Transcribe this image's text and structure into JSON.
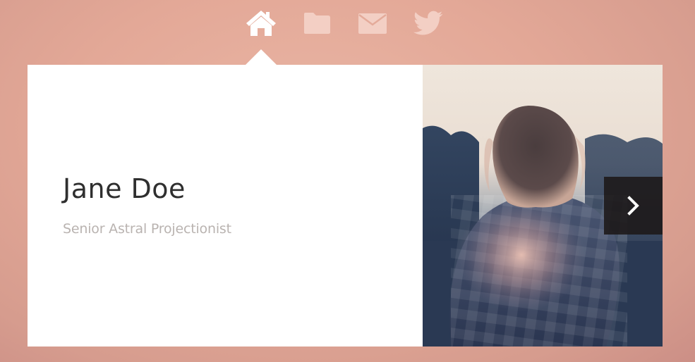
{
  "nav": {
    "items": [
      {
        "icon": "home-icon",
        "active": true
      },
      {
        "icon": "folder-icon",
        "active": false
      },
      {
        "icon": "mail-icon",
        "active": false
      },
      {
        "icon": "twitter-icon",
        "active": false
      }
    ],
    "active_color": "#ffffff",
    "inactive_color": "#f3cfc4"
  },
  "profile": {
    "name": "Jane Doe",
    "title": "Senior Astral Projectionist"
  },
  "photo": {
    "subject": "woman-seen-from-behind-backlit"
  },
  "carousel": {
    "next_icon": "chevron-right-icon"
  }
}
